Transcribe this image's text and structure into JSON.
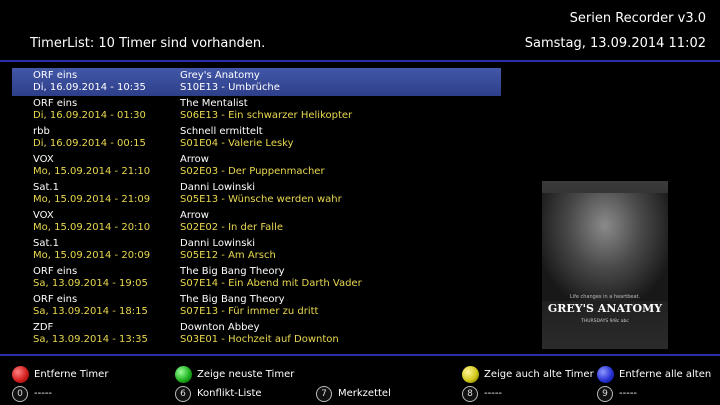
{
  "app": {
    "title": "Serien Recorder v3.0"
  },
  "header": {
    "title": "TimerList: 10 Timer sind vorhanden.",
    "datetime": "Samstag, 13.09.2014  11:02"
  },
  "timers": [
    {
      "channel": "ORF eins",
      "datetime": "Di, 16.09.2014 - 10:35",
      "series": "Grey's Anatomy",
      "episode": "S10E13 - Umbrüche"
    },
    {
      "channel": "ORF eins",
      "datetime": "Di, 16.09.2014 - 01:30",
      "series": "The Mentalist",
      "episode": "S06E13 - Ein schwarzer Helikopter"
    },
    {
      "channel": "rbb",
      "datetime": "Di, 16.09.2014 - 00:15",
      "series": "Schnell ermittelt",
      "episode": "S01E04 - Valerie Lesky"
    },
    {
      "channel": "VOX",
      "datetime": "Mo, 15.09.2014 - 21:10",
      "series": "Arrow",
      "episode": "S02E03 - Der Puppenmacher"
    },
    {
      "channel": "Sat.1",
      "datetime": "Mo, 15.09.2014 - 21:09",
      "series": "Danni Lowinski",
      "episode": "S05E13 - Wünsche werden wahr"
    },
    {
      "channel": "VOX",
      "datetime": "Mo, 15.09.2014 - 20:10",
      "series": "Arrow",
      "episode": "S02E02 - In der Falle"
    },
    {
      "channel": "Sat.1",
      "datetime": "Mo, 15.09.2014 - 20:09",
      "series": "Danni Lowinski",
      "episode": "S05E12 - Am Arsch"
    },
    {
      "channel": "ORF eins",
      "datetime": "Sa, 13.09.2014 - 19:05",
      "series": "The Big Bang Theory",
      "episode": "S07E14 - Ein Abend mit Darth Vader"
    },
    {
      "channel": "ORF eins",
      "datetime": "Sa, 13.09.2014 - 18:15",
      "series": "The Big Bang Theory",
      "episode": "S07E13 - Für immer zu dritt"
    },
    {
      "channel": "ZDF",
      "datetime": "Sa, 13.09.2014 - 13:35",
      "series": "Downton Abbey",
      "episode": "S03E01 - Hochzeit auf Downton"
    }
  ],
  "poster": {
    "tagline": "Life changes in a heartbeat.",
    "logo": "GREY'S ANATOMY",
    "airdate": "THURSDAYS 9/8c abc"
  },
  "footer": {
    "red": {
      "label": "Entferne Timer",
      "color": "#d42020"
    },
    "green": {
      "label": "Zeige neuste Timer",
      "color": "#1fb21f"
    },
    "yellow": {
      "label": "Zeige auch alte Timer",
      "color": "#d2c81a"
    },
    "blue": {
      "label": "Entferne alle alten",
      "color": "#2a34d6"
    },
    "key0": {
      "num": "0",
      "label": "-----"
    },
    "key6": {
      "num": "6",
      "label": "Konflikt-Liste"
    },
    "key7": {
      "num": "7",
      "label": "Merkzettel"
    },
    "key8": {
      "num": "8",
      "label": "-----"
    },
    "key9": {
      "num": "9",
      "label": "-----"
    }
  }
}
